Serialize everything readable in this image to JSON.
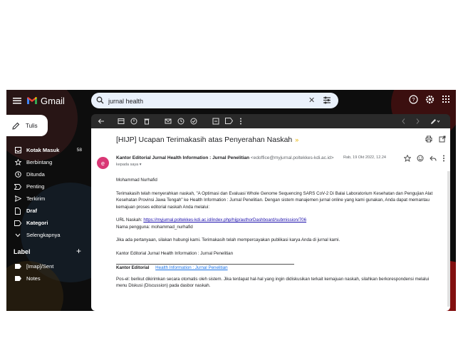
{
  "app": {
    "name": "Gmail"
  },
  "search": {
    "value": "jurnal health"
  },
  "sidebar": {
    "compose_label": "Tulis",
    "items": [
      {
        "label": "Kotak Masuk",
        "count": "58",
        "icon": "inbox-icon",
        "bold": true
      },
      {
        "label": "Berbintang",
        "count": "",
        "icon": "star-icon",
        "bold": false
      },
      {
        "label": "Ditunda",
        "count": "",
        "icon": "clock-icon",
        "bold": false
      },
      {
        "label": "Penting",
        "count": "",
        "icon": "important-icon",
        "bold": false
      },
      {
        "label": "Terkirim",
        "count": "",
        "icon": "send-icon",
        "bold": false
      },
      {
        "label": "Draf",
        "count": "",
        "icon": "draft-icon",
        "bold": true
      },
      {
        "label": "Kategori",
        "count": "",
        "icon": "label-icon",
        "bold": true
      },
      {
        "label": "Selengkapnya",
        "count": "",
        "icon": "chevron-down-icon",
        "bold": false
      }
    ],
    "labels_header": "Label",
    "labels": [
      {
        "label": "[Imap]/Sent"
      },
      {
        "label": "Notes"
      }
    ]
  },
  "email": {
    "subject": "[HIJP] Ucapan Terimakasih atas Penyerahan Naskah",
    "sender_name": "Kantor Editorial Jurnal Health Information : Jurnal Penelitian",
    "sender_email": "<edoffice@myjurnal.poltekkes-kdi.ac.id>",
    "to": "kepada saya",
    "date": "Rab, 19 Okt 2022, 12.24",
    "avatar_letter": "e",
    "greeting": "Mohammad Nurhafid",
    "para1": "Terimakasih telah menyerahkan naskah, \"A Optimasi dan Evaluasi Whole Genome Sequencing SARS CoV-2 Di Balai Laboratorium Kesehatan dan Pengujian Alat Kesehatan Provinsi Jawa Tengah\" ke Health Information : Jurnal Penelitian. Dengan sistem manajemen jurnal online yang kami gunakan, Anda dapat memantau kemajuan proses editorial naskah Anda melalui:",
    "url_label": "URL Naskah:",
    "url": "https://myjurnal.poltekkes-kdi.ac.id/index.php/hijp/authorDashboard/submission/706",
    "username_label": "Nama pengguna:",
    "username": "mohammad_nurhafid",
    "para2": "Jika ada pertanyaan, silakan hubungi kami. Terimakasih telah mempercayakan publikasi karya Anda di jurnal kami.",
    "signoff": "Kantor Editorial Jurnal Health Information : Jurnal Penelitian",
    "sig_bold": "Kantor Editorial",
    "sig_link": "Health Information : Jurnal Penelitian",
    "footer": "Pos-el: berikut dikirimkan secara otomatis oleh sistem. Jika terdapat hal-hal yang ingin didiskusikan terkait kemajuan naskah, silahkan berkorespondensi melalui menu Diskusi (Discussion) pada dasbor naskah."
  }
}
